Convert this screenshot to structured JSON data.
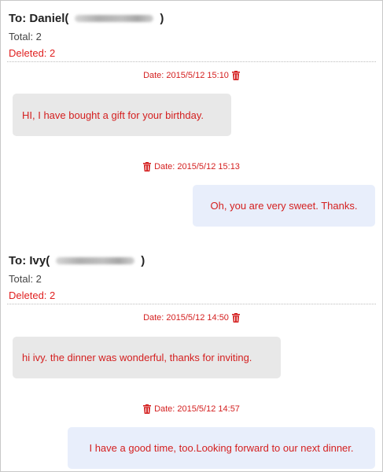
{
  "conversations": [
    {
      "to_prefix": "To: Daniel(",
      "to_suffix": ")",
      "total": "Total: 2",
      "deleted": "Deleted: 2",
      "messages": [
        {
          "date": "Date: 2015/5/12 15:10",
          "text": "HI, I have bought a gift for your birthday.",
          "direction": "incoming"
        },
        {
          "date": "Date: 2015/5/12 15:13",
          "text": "Oh, you are very sweet. Thanks.",
          "direction": "outgoing"
        }
      ]
    },
    {
      "to_prefix": "To: Ivy(",
      "to_suffix": ")",
      "total": "Total: 2",
      "deleted": "Deleted: 2",
      "messages": [
        {
          "date": "Date: 2015/5/12 14:50",
          "text": "hi ivy. the dinner was wonderful, thanks for inviting.",
          "direction": "incoming"
        },
        {
          "date": "Date: 2015/5/12 14:57",
          "text": "I have a good time, too.Looking forward to our next dinner.",
          "direction": "outgoing"
        }
      ]
    }
  ],
  "icons": {
    "delete": "trash-icon",
    "redacted": "blurred-phone-number"
  },
  "colors": {
    "accent_red": "#d42020",
    "incoming_bubble": "#e8e8e8",
    "outgoing_bubble": "#e8eefb"
  }
}
